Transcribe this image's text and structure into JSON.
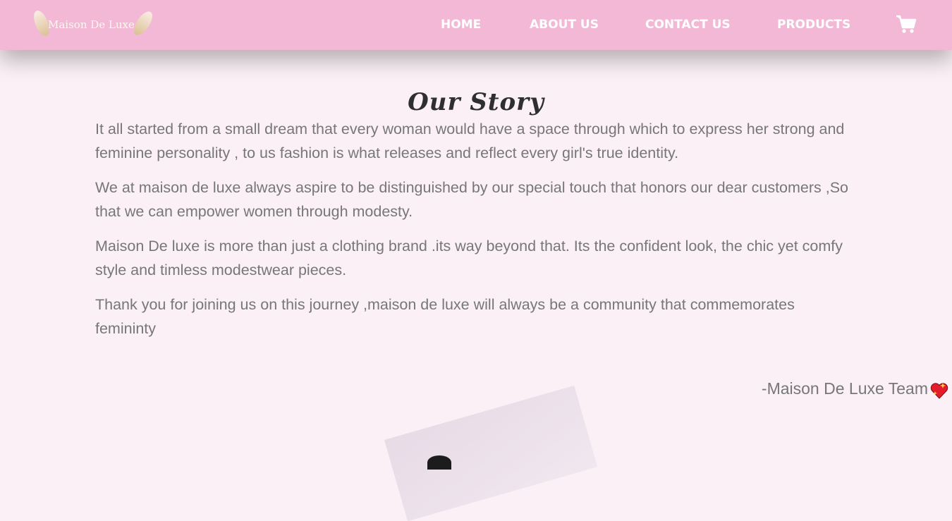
{
  "brand": {
    "logo_text": "Maison De Luxe"
  },
  "nav": {
    "home": "HOME",
    "about": "ABOUT US",
    "contact": "CONTACT US",
    "products": "PRODUCTS",
    "cart_icon": "cart-icon"
  },
  "story": {
    "title": "Our Story",
    "paragraphs": [
      "It all started from a small dream that every woman would have a space through which to express her strong and feminine personality , to us fashion is what releases and reflect every girl's true identity.",
      "We at maison de luxe always aspire to be distinguished by our special touch that honors our dear customers ,So that we can empower women through modesty.",
      "Maison De luxe is more than just a clothing brand .its way beyond that. Its the confident look, the chic yet comfy style and timless modestwear pieces.",
      "Thank you for joining us on this journey ,maison de luxe will always be a community that commemorates femininty"
    ],
    "signature": "-Maison De Luxe Team",
    "signature_icon": "sparkling-heart-icon"
  },
  "colors": {
    "navbar": "#f2b8d6",
    "page_background": "#faf0f5",
    "body_text": "#777777",
    "nav_text": "#ffffff"
  }
}
